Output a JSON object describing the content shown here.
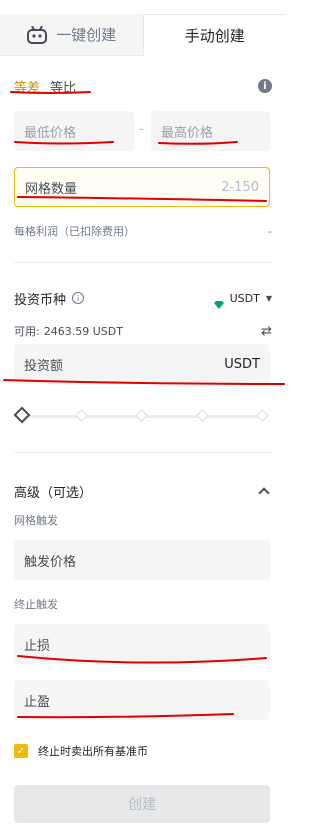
{
  "tabs": {
    "one_click": "一键创建",
    "manual": "手动创建"
  },
  "mode": {
    "arithmetic": "等差",
    "geometric": "等比"
  },
  "price": {
    "min_placeholder": "最低价格",
    "max_placeholder": "最高价格",
    "separator": "-"
  },
  "grid": {
    "placeholder": "网格数量",
    "range": "2-150"
  },
  "profit": {
    "label": "每格利润（已扣除费用）",
    "value": "-"
  },
  "investment": {
    "label": "投资币种",
    "currency": "USDT",
    "available_label": "可用:",
    "available_value": "2463.59 USDT",
    "amount_placeholder": "投资额",
    "amount_unit": "USDT"
  },
  "advanced": {
    "title": "高级（可选）",
    "trigger_label": "网格触发",
    "trigger_placeholder": "触发价格",
    "stop_label": "终止触发",
    "stop_loss_placeholder": "止损",
    "take_profit_placeholder": "止盈",
    "sell_all_label": "终止时卖出所有基准币",
    "sell_all_checked": true
  },
  "create_button": "创建",
  "colors": {
    "accent": "#f0b90b",
    "selected_text": "#c99400",
    "annotation": "#e00000"
  }
}
